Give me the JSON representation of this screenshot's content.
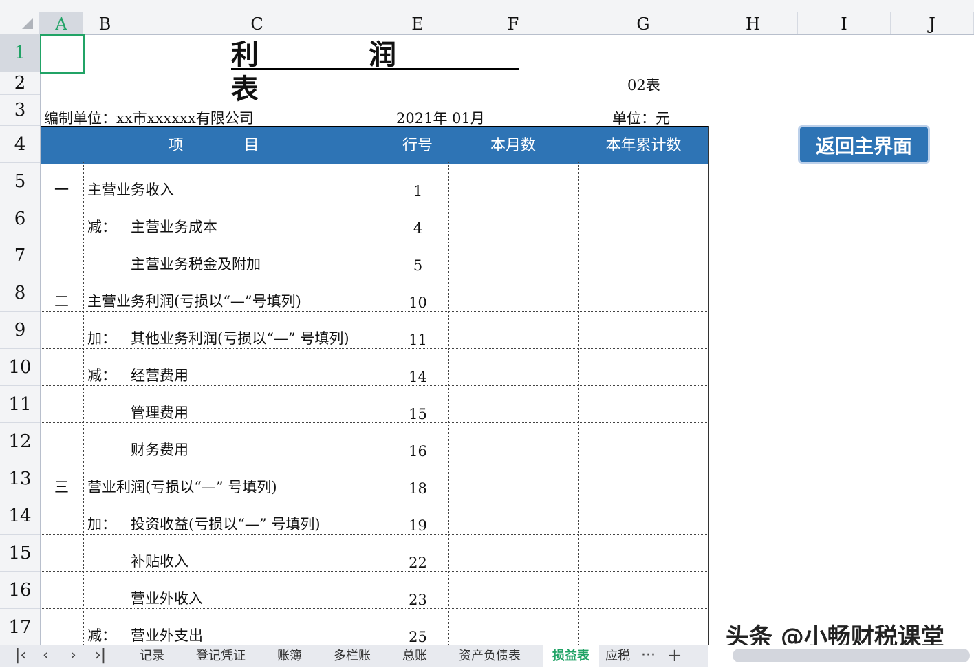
{
  "columns": [
    "A",
    "B",
    "C",
    "E",
    "F",
    "G",
    "H",
    "I",
    "J"
  ],
  "rows": [
    "1",
    "2",
    "3",
    "4",
    "5",
    "6",
    "7",
    "8",
    "9",
    "10",
    "11",
    "12",
    "13",
    "14",
    "15",
    "16",
    "17"
  ],
  "title": "利　　　　润　　　　表",
  "form_no": "02表",
  "unit_label": "编制单位：xx市xxxxxx有限公司",
  "period": "2021年  01月",
  "currency": "单位：元",
  "headers": {
    "item": "项　　　　目",
    "line": "行号",
    "month": "本月数",
    "year": "本年累计数"
  },
  "items": [
    {
      "num": "一",
      "prefix": "",
      "label": "主营业务收入",
      "line": "1",
      "indent": false
    },
    {
      "num": "",
      "prefix": "减：",
      "label": "主营业务成本",
      "line": "4",
      "indent": true
    },
    {
      "num": "",
      "prefix": "",
      "label": "主营业务税金及附加",
      "line": "5",
      "indent": true
    },
    {
      "num": "二",
      "prefix": "",
      "label": "主营业务利润(亏损以“—”号填列)",
      "line": "10",
      "indent": false
    },
    {
      "num": "",
      "prefix": "加：",
      "label": "其他业务利润(亏损以“—” 号填列)",
      "line": "11",
      "indent": true
    },
    {
      "num": "",
      "prefix": "减：",
      "label": "经营费用",
      "line": "14",
      "indent": true
    },
    {
      "num": "",
      "prefix": "",
      "label": "管理费用",
      "line": "15",
      "indent": true
    },
    {
      "num": "",
      "prefix": "",
      "label": "财务费用",
      "line": "16",
      "indent": true
    },
    {
      "num": "三",
      "prefix": "",
      "label": "营业利润(亏损以“—” 号填列)",
      "line": "18",
      "indent": false
    },
    {
      "num": "",
      "prefix": "加：",
      "label": "投资收益(亏损以“—” 号填列)",
      "line": "19",
      "indent": true
    },
    {
      "num": "",
      "prefix": "",
      "label": "补贴收入",
      "line": "22",
      "indent": true
    },
    {
      "num": "",
      "prefix": "",
      "label": "营业外收入",
      "line": "23",
      "indent": true
    },
    {
      "num": "",
      "prefix": "减：",
      "label": "营业外支出",
      "line": "25",
      "indent": true
    }
  ],
  "return_button": "返回主界面",
  "sheet_tabs": [
    "记录",
    "登记凭证",
    "账簿",
    "多栏账",
    "总账",
    "资产负债表",
    "损益表",
    "应税"
  ],
  "active_tab": "损益表",
  "more": "···",
  "add": "+",
  "watermark": "头条 @小畅财税课堂"
}
